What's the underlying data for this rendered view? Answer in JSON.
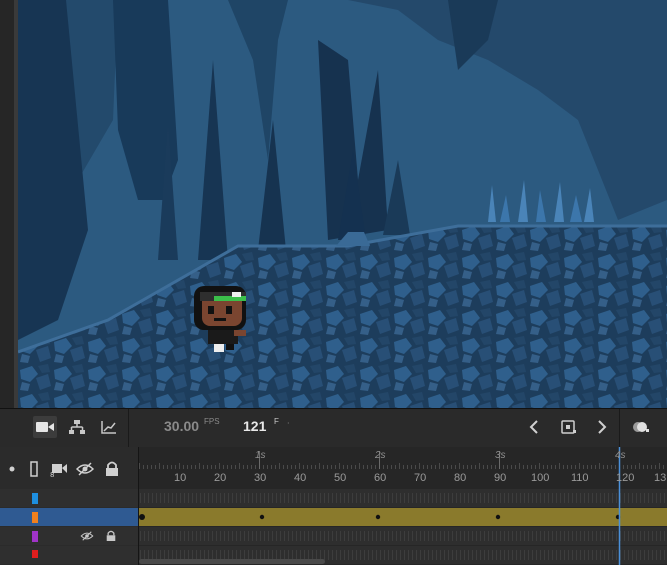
{
  "toolbar": {
    "fps_value": "30.00",
    "fps_unit": "FPS",
    "frame_value": "121",
    "frame_unit": "F",
    "frame_suffix": "·",
    "camera_icon": "camera-icon",
    "hierarchy_icon": "layer-parenting-icon",
    "graph_icon": "graph-icon",
    "prev_icon": "chevron-left-icon",
    "keyframe_icon": "insert-keyframe-icon",
    "next_icon": "chevron-right-icon",
    "onion_icon": "onion-skin-icon"
  },
  "timeline": {
    "header_icons": [
      "show-all-dot-icon",
      "outline-icon",
      "camera-attach-icon",
      "eye-hidden-icon",
      "lock-icon"
    ],
    "seconds": [
      "1s",
      "2s",
      "3s",
      "4s"
    ],
    "frame_numbers": [
      "10",
      "20",
      "30",
      "40",
      "50",
      "60",
      "70",
      "80",
      "90",
      "100",
      "110",
      "120",
      "13"
    ],
    "playhead_frame": 121,
    "layers": [
      {
        "color": "#1e8fe0",
        "selected": false
      },
      {
        "color": "#f0801e",
        "selected": true
      },
      {
        "color": "#a034c8",
        "selected": false,
        "hidden": true,
        "locked": true
      },
      {
        "color": "#e01e1e",
        "selected": false
      }
    ],
    "keyframes_layer2": [
      1,
      31,
      60,
      90,
      120
    ]
  },
  "colors": {
    "selected_row": "#2f5a92",
    "tween_span": "#8a7a2c",
    "playhead": "#4a90d9"
  }
}
